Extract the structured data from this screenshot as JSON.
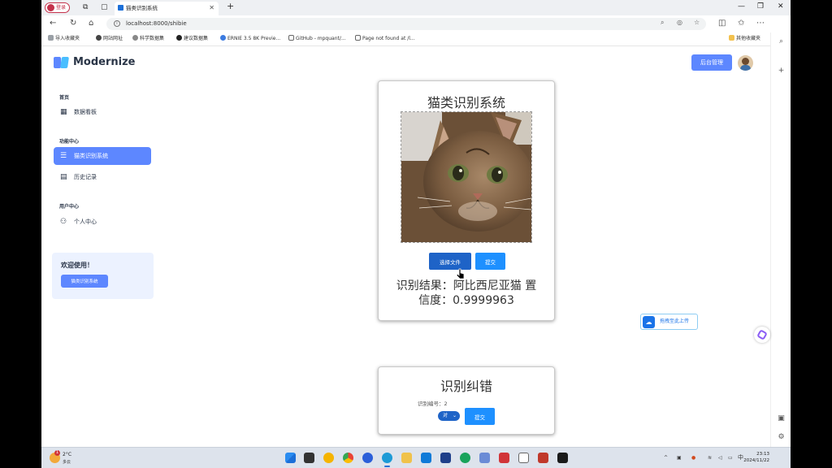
{
  "browser": {
    "profile_label": "登录",
    "tab_title": "猫类识别系统",
    "url": "localhost:8000/shibie",
    "bookmarks": [
      "导入收藏夹",
      "网站网址",
      "科学数据集",
      "建议数据集",
      "ERNIE 3.5 8K Previe...",
      "GitHub - mpquant/...",
      "Page not found at /l...",
      "其他收藏夹"
    ]
  },
  "header": {
    "brand": "Modernize",
    "admin_button": "后台管理",
    "brand_colors": {
      "primary": "#5d87ff",
      "dark": "#2a3547"
    }
  },
  "sidebar": {
    "sections": [
      {
        "title": "首页",
        "items": [
          {
            "label": "数据看板",
            "icon": "dashboard-icon"
          }
        ]
      },
      {
        "title": "功能中心",
        "items": [
          {
            "label": "猫类识别系统",
            "icon": "list-icon",
            "active": true
          },
          {
            "label": "历史记录",
            "icon": "document-icon"
          }
        ]
      },
      {
        "title": "用户中心",
        "items": [
          {
            "label": "个人中心",
            "icon": "user-add-icon"
          }
        ]
      }
    ],
    "welcome": {
      "title": "欢迎使用！",
      "button": "猫类识别系统"
    }
  },
  "recognition": {
    "title": "猫类识别系统",
    "choose_file": "选择文件",
    "submit": "提交",
    "result_line1": "识别结果：阿比西尼亚猫 置",
    "result_line2": "信度：0.9999963"
  },
  "correction": {
    "title": "识别纠错",
    "id_label": "识别编号：2",
    "select_value": "对",
    "submit": "提交"
  },
  "floating": {
    "upload": "拖拽至此上传"
  },
  "taskbar": {
    "temperature": "2°C",
    "weather": "多云",
    "badge": "1",
    "time": "23:13",
    "date": "2024/11/22",
    "tray_language": "中"
  }
}
